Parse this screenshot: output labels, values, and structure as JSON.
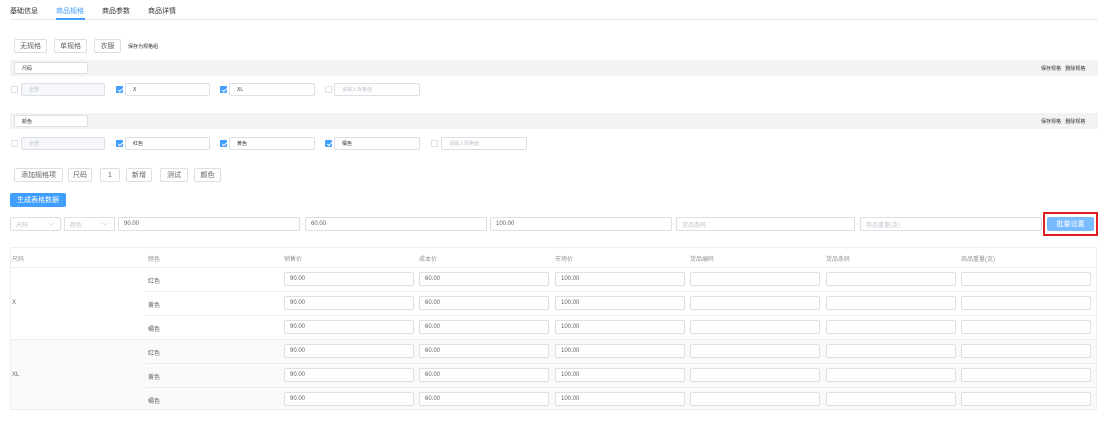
{
  "tabs": [
    {
      "label": "基础信息",
      "active": false
    },
    {
      "label": "商品规格",
      "active": true
    },
    {
      "label": "商品参数",
      "active": false
    },
    {
      "label": "商品详情",
      "active": false
    }
  ],
  "spec_mode_buttons": [
    "无规格",
    "单规格",
    "衣服"
  ],
  "save_as_template": "保存为规格组",
  "spec_actions": {
    "save": "保存规格",
    "delete": "删除规格"
  },
  "spec_groups": [
    {
      "name": "尺码",
      "all_label": "全部",
      "values": [
        {
          "label": "X",
          "checked": true
        },
        {
          "label": "XL",
          "checked": true
        }
      ],
      "new_placeholder": "请输入规格值"
    },
    {
      "name": "颜色",
      "all_label": "全部",
      "values": [
        {
          "label": "红色",
          "checked": true
        },
        {
          "label": "黄色",
          "checked": true
        },
        {
          "label": "橘色",
          "checked": true
        }
      ],
      "new_placeholder": "请输入规格值"
    }
  ],
  "add_spec_button": "添加规格项",
  "spec_chips": [
    "尺码",
    "1",
    "新增",
    "测试",
    "颜色"
  ],
  "generate_button": "生成表格数据",
  "batch": {
    "select_size": "尺码",
    "select_color": "颜色",
    "price": "90.00",
    "cost": "60.00",
    "market": "100.00",
    "barcode_placeholder": "货品条码",
    "weight_placeholder": "商品重量(克)",
    "button": "批量设置"
  },
  "table": {
    "headers": [
      "尺码",
      "颜色",
      "销售价",
      "成本价",
      "市场价",
      "货品编码",
      "货品条码",
      "商品重量(克)"
    ],
    "groups": [
      {
        "size": "X",
        "rows": [
          {
            "color": "红色",
            "price": "90.00",
            "cost": "60.00",
            "market": "100.00"
          },
          {
            "color": "黄色",
            "price": "90.00",
            "cost": "60.00",
            "market": "100.00"
          },
          {
            "color": "橘色",
            "price": "90.00",
            "cost": "60.00",
            "market": "100.00"
          }
        ]
      },
      {
        "size": "XL",
        "rows": [
          {
            "color": "红色",
            "price": "90.00",
            "cost": "60.00",
            "market": "100.00"
          },
          {
            "color": "黄色",
            "price": "90.00",
            "cost": "60.00",
            "market": "100.00"
          },
          {
            "color": "橘色",
            "price": "90.00",
            "cost": "60.00",
            "market": "100.00"
          }
        ]
      }
    ]
  },
  "colors": {
    "primary": "#409eff",
    "highlight": "#e02020",
    "border": "#dcdfe6"
  }
}
